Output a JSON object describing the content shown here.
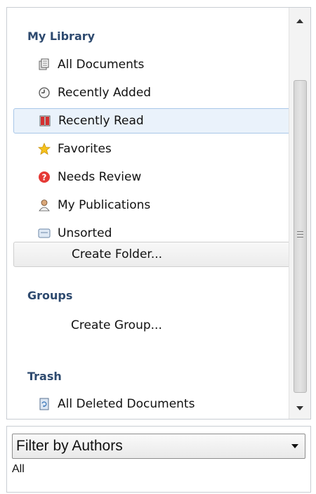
{
  "library": {
    "my_library_header": "My Library",
    "items": [
      {
        "label": "All Documents",
        "icon": "documents-icon"
      },
      {
        "label": "Recently Added",
        "icon": "clock-icon"
      },
      {
        "label": "Recently Read",
        "icon": "book-icon",
        "selected": true
      },
      {
        "label": "Favorites",
        "icon": "star-icon"
      },
      {
        "label": "Needs Review",
        "icon": "question-icon"
      },
      {
        "label": "My Publications",
        "icon": "person-icon"
      },
      {
        "label": "Unsorted",
        "icon": "inbox-icon"
      }
    ],
    "create_folder_label": "Create Folder...",
    "groups_header": "Groups",
    "create_group_label": "Create Group...",
    "trash_header": "Trash",
    "trash_item_label": "All Deleted Documents"
  },
  "filter": {
    "selected": "Filter by Authors",
    "value": "All"
  },
  "colors": {
    "section_header": "#2e4a6f",
    "selected_bg": "#eaf2fb",
    "selected_border": "#a9c7e8"
  }
}
